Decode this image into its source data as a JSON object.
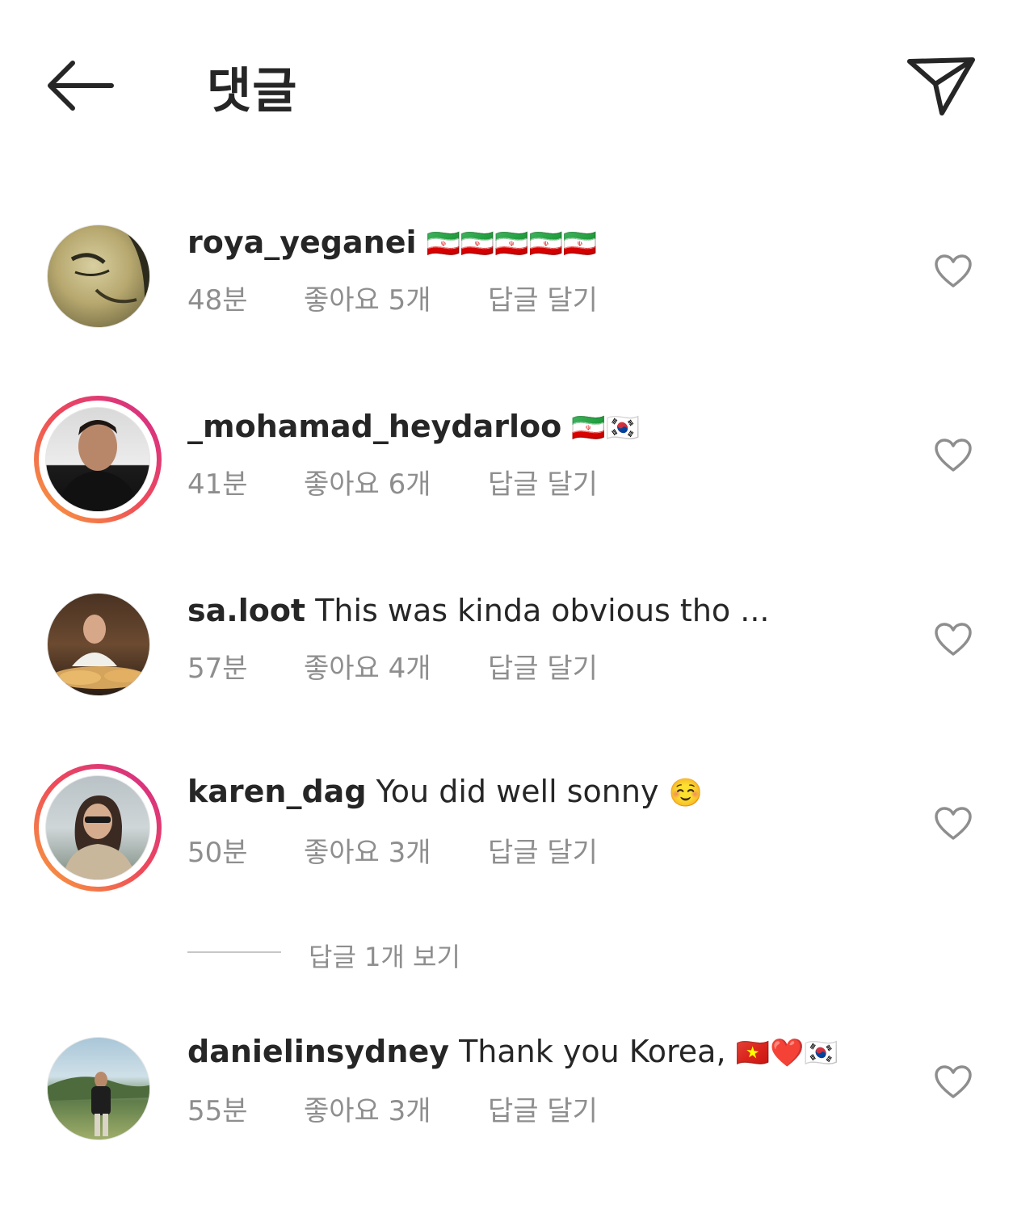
{
  "header": {
    "title": "댓글",
    "back_icon": "arrow-left-icon",
    "share_icon": "paper-plane-icon"
  },
  "comments": [
    {
      "username": "roya_yeganei",
      "text": "",
      "emoji": "🇮🇷🇮🇷🇮🇷🇮🇷🇮🇷",
      "time": "48분",
      "likes": "좋아요 5개",
      "reply": "답글 달기",
      "story_ring": false
    },
    {
      "username": "_mohamad_heydarloo",
      "text": "",
      "emoji": "🇮🇷🇰🇷",
      "time": "41분",
      "likes": "좋아요 6개",
      "reply": "답글 달기",
      "story_ring": true
    },
    {
      "username": "sa.loot",
      "text": "This was kinda obvious tho ...",
      "emoji": "",
      "time": "57분",
      "likes": "좋아요 4개",
      "reply": "답글 달기",
      "story_ring": false
    },
    {
      "username": "karen_dag",
      "text": "You did well sonny",
      "emoji": "☺️",
      "time": "50분",
      "likes": "좋아요 3개",
      "reply": "답글 달기",
      "story_ring": true
    },
    {
      "username": "danielinsydney",
      "text": "Thank you Korea,",
      "emoji": "🇻🇳❤️🇰🇷",
      "time": "55분",
      "likes": "좋아요 3개",
      "reply": "답글 달기",
      "story_ring": false
    }
  ],
  "view_replies": "답글 1개 보기",
  "colors": {
    "text": "#262626",
    "meta": "#8e8e8e",
    "ring_start": "#f9a23a",
    "ring_end": "#d12a8c"
  }
}
